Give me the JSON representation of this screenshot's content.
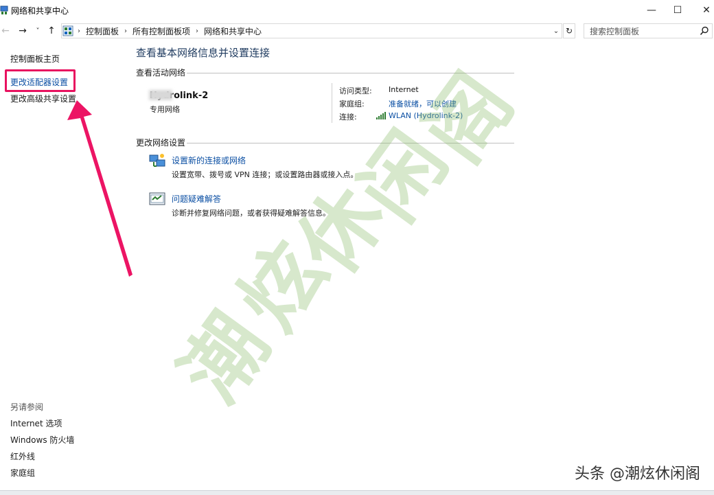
{
  "window": {
    "title": "网络和共享中心",
    "min_glyph": "—",
    "max_glyph": "☐",
    "close_glyph": "✕"
  },
  "nav": {
    "back_glyph": "←",
    "forward_glyph": "→",
    "recent_glyph": "˅",
    "up_glyph": "↑",
    "sep_glyph": "›",
    "breadcrumbs": [
      "控制面板",
      "所有控制面板项",
      "网络和共享中心"
    ],
    "dropdown_glyph": "⌄",
    "refresh_glyph": "↻",
    "search_placeholder": "搜索控制面板"
  },
  "sidebar": {
    "home": "控制面板主页",
    "items": [
      {
        "label": "更改适配器设置"
      },
      {
        "label": "更改高级共享设置"
      }
    ],
    "see_also_title": "另请参阅",
    "see_also": [
      "Internet 选项",
      "Windows 防火墙",
      "红外线",
      "家庭组"
    ]
  },
  "main": {
    "title": "查看基本网络信息并设置连接",
    "active_section": "查看活动网络",
    "network": {
      "name": "Hydrolink-2",
      "type": "专用网络",
      "access_type_key": "访问类型:",
      "access_type_val": "Internet",
      "homegroup_key": "家庭组:",
      "homegroup_val": "准备就绪，可以创建",
      "connection_key": "连接:",
      "connection_val": "WLAN (Hydrolink-2)"
    },
    "change_section": "更改网络设置",
    "tasks": [
      {
        "label": "设置新的连接或网络",
        "desc": "设置宽带、拨号或 VPN 连接；或设置路由器或接入点。"
      },
      {
        "label": "问题疑难解答",
        "desc": "诊断并修复网络问题，或者获得疑难解答信息。"
      }
    ]
  },
  "watermark": {
    "chars": [
      "潮",
      "炫",
      "休",
      "闲",
      "阁"
    ]
  },
  "corner_mark": "头条 @潮炫休闲阁",
  "colors": {
    "accent_link": "#0b4fa3",
    "highlight": "#e8115f",
    "watermark": "#8cbe6e"
  }
}
